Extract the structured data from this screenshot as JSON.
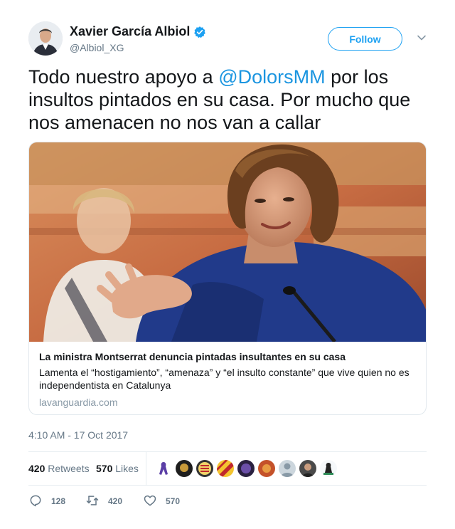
{
  "author": {
    "name": "Xavier García Albiol",
    "handle": "@Albiol_XG"
  },
  "follow_label": "Follow",
  "tweet": {
    "text_before": "Todo nuestro apoyo a ",
    "mention": "@DolorsMM",
    "text_after": " por los insultos pintados en su casa. Por mucho que nos amenacen no nos van a callar"
  },
  "card": {
    "title": "La ministra Montserrat denuncia pintadas insultantes en su casa",
    "description": "Lamenta el “hostigamiento”, “amenaza” y “el insulto constante” que vive quien no es independentista en Catalunya",
    "domain": "lavanguardia.com"
  },
  "timestamp": "4:10 AM - 17 Oct 2017",
  "stats": {
    "retweets_count": "420",
    "retweets_label": "Retweets",
    "likes_count": "570",
    "likes_label": "Likes"
  },
  "actions": {
    "replies": "128",
    "retweets": "420",
    "likes": "570"
  },
  "colors": {
    "accent": "#1da1f2",
    "mention": "#1b95e0",
    "text": "#14171a",
    "muted": "#657786"
  }
}
